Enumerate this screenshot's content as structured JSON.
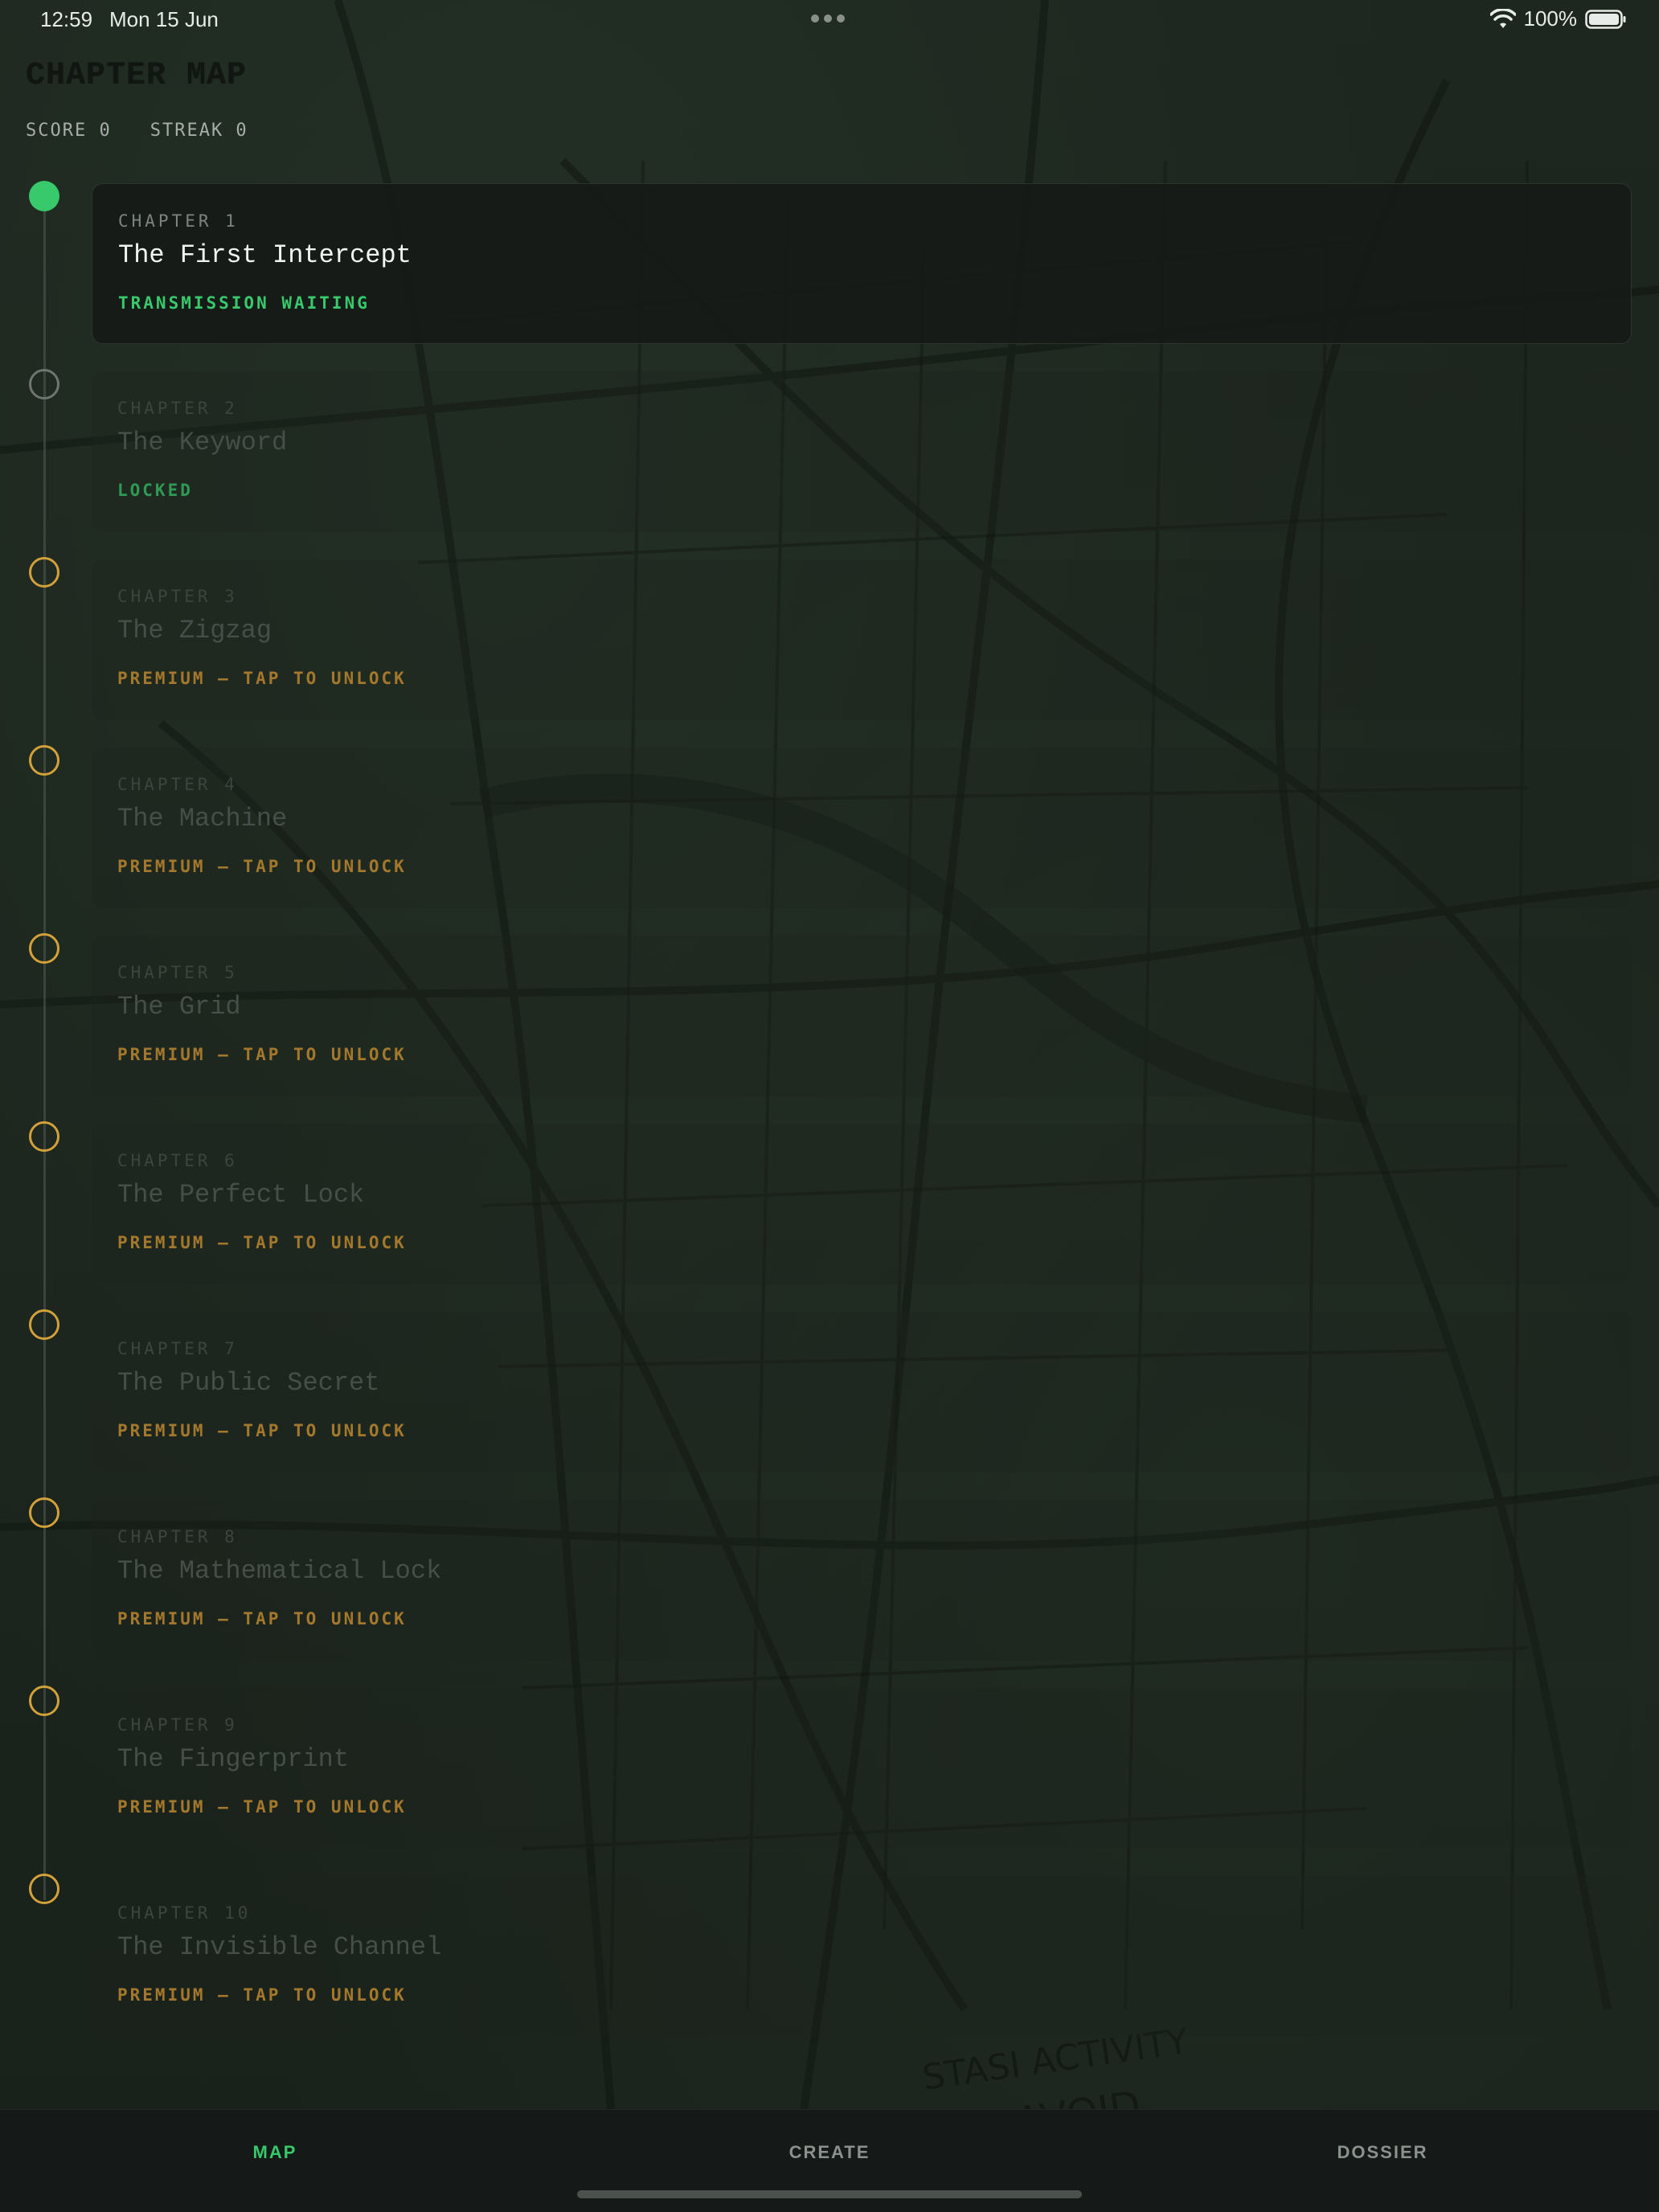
{
  "status_bar": {
    "time": "12:59",
    "date": "Mon 15 Jun",
    "battery": "100%"
  },
  "header": {
    "title": "CHAPTER MAP",
    "score": "SCORE 0",
    "streak": "STREAK 0"
  },
  "map_annotation": "STASI ACTIVITY AVOID",
  "chapters": [
    {
      "number": "CHAPTER 1",
      "title": "The First Intercept",
      "status": "TRANSMISSION WAITING",
      "state": "active"
    },
    {
      "number": "CHAPTER 2",
      "title": "The Keyword",
      "status": "LOCKED",
      "state": "locked"
    },
    {
      "number": "CHAPTER 3",
      "title": "The Zigzag",
      "status": "PREMIUM — TAP TO UNLOCK",
      "state": "premium"
    },
    {
      "number": "CHAPTER 4",
      "title": "The Machine",
      "status": "PREMIUM — TAP TO UNLOCK",
      "state": "premium"
    },
    {
      "number": "CHAPTER 5",
      "title": "The Grid",
      "status": "PREMIUM — TAP TO UNLOCK",
      "state": "premium"
    },
    {
      "number": "CHAPTER 6",
      "title": "The Perfect Lock",
      "status": "PREMIUM — TAP TO UNLOCK",
      "state": "premium"
    },
    {
      "number": "CHAPTER 7",
      "title": "The Public Secret",
      "status": "PREMIUM — TAP TO UNLOCK",
      "state": "premium"
    },
    {
      "number": "CHAPTER 8",
      "title": "The Mathematical Lock",
      "status": "PREMIUM — TAP TO UNLOCK",
      "state": "premium"
    },
    {
      "number": "CHAPTER 9",
      "title": "The Fingerprint",
      "status": "PREMIUM — TAP TO UNLOCK",
      "state": "premium"
    },
    {
      "number": "CHAPTER 10",
      "title": "The Invisible Channel",
      "status": "PREMIUM — TAP TO UNLOCK",
      "state": "premium"
    }
  ],
  "tabs": [
    {
      "label": "MAP",
      "selected": true
    },
    {
      "label": "CREATE",
      "selected": false
    },
    {
      "label": "DOSSIER",
      "selected": false
    }
  ],
  "colors": {
    "accent_green": "#37c96b",
    "premium_amber": "#d3a13a",
    "background": "#1a221c"
  },
  "icons": [
    "wifi-icon",
    "battery-icon",
    "multitasking-dots-icon"
  ]
}
